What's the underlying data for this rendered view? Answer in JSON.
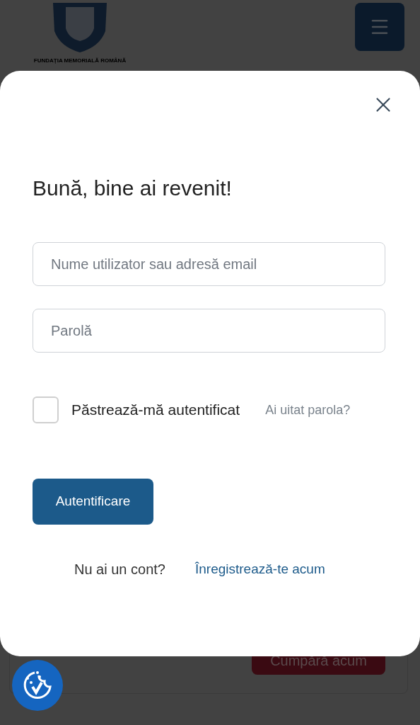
{
  "header": {
    "logo_caption": "FUNDAȚIA MEMORIALĂ ROMÂNĂ"
  },
  "product_card": {
    "buy_button": "Cumpără acum"
  },
  "login_modal": {
    "title": "Bună, bine ai revenit!",
    "fields": [
      {
        "placeholder": "Nume utilizator sau adresă email"
      },
      {
        "placeholder": "Parolă"
      }
    ],
    "remember": {
      "label": "Păstrează-mă autentificat",
      "checked": false
    },
    "forgot_link": "Ai uitat parola?",
    "submit": "Autentificare",
    "register_prompt": "Nu ai un cont?",
    "register_link": "Înregistrează-te acum"
  }
}
